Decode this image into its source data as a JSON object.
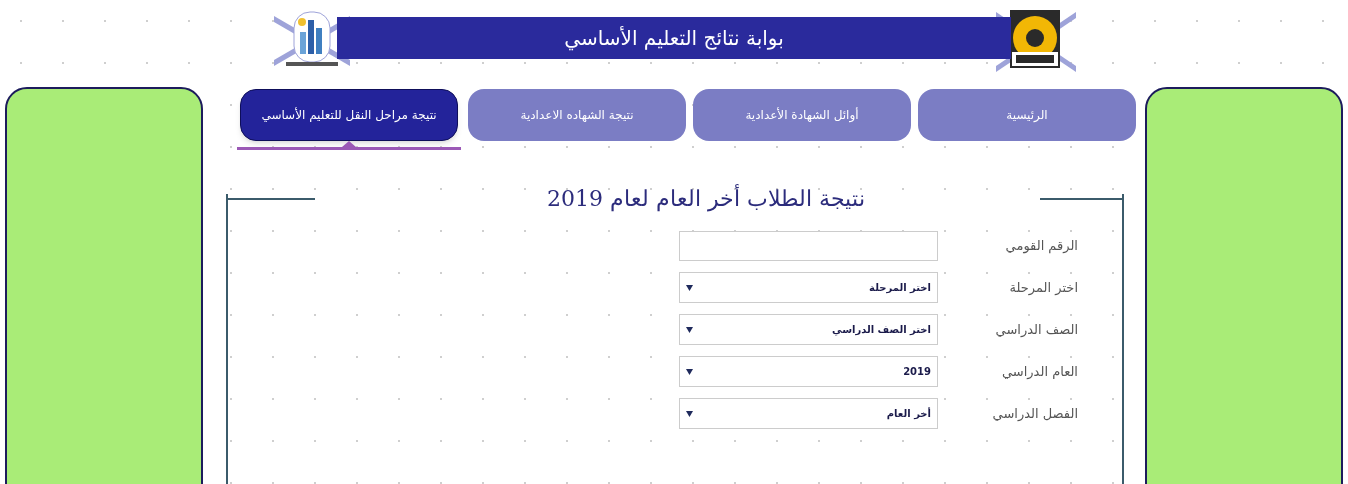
{
  "header": {
    "title": "بوابة نتائج التعليم الأساسي"
  },
  "tabs": [
    {
      "label": "الرئيسية",
      "selected": false
    },
    {
      "label": "أوائل الشهادة الأعدادية",
      "selected": false
    },
    {
      "label": "نتيجة الشهاده الاعدادية",
      "selected": false
    },
    {
      "label": "نتيجة مراحل النقل للتعليم الأساسي",
      "selected": true
    }
  ],
  "form": {
    "title": "نتيجة الطلاب أخر العام لعام 2019",
    "fields": [
      {
        "label": "الرقم القومي",
        "kind": "text"
      },
      {
        "label": "اختر المرحلة",
        "kind": "select",
        "value": "اختر المرحلة"
      },
      {
        "label": "الصف الدراسي",
        "kind": "select",
        "value": "اختر الصف الدراسي"
      },
      {
        "label": "العام الدراسي",
        "kind": "select",
        "value": "2019"
      },
      {
        "label": "الفصل الدراسي",
        "kind": "select",
        "value": "أخر العام"
      }
    ]
  }
}
